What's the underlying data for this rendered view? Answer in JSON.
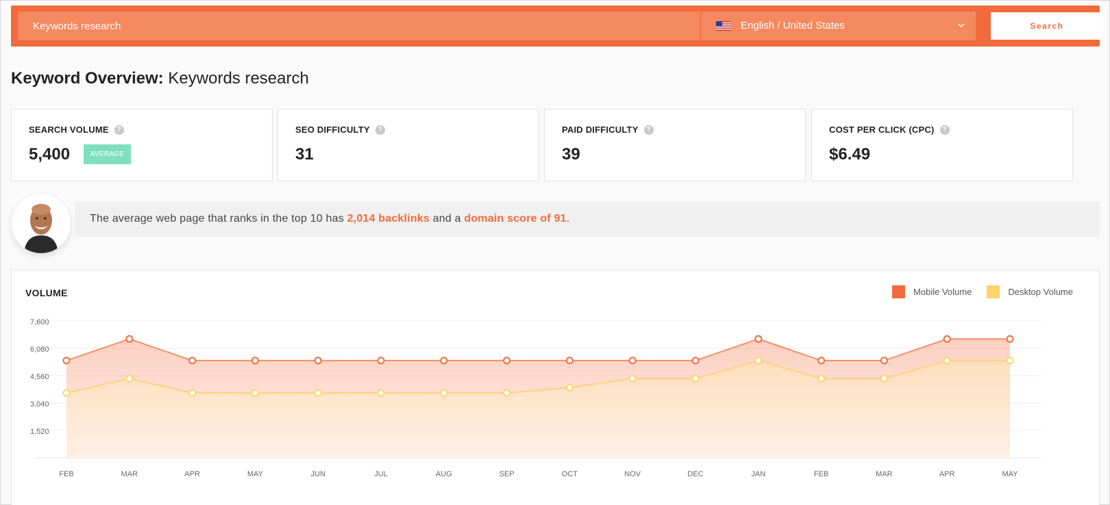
{
  "search": {
    "input_value": "Keywords research",
    "language_label": "English / United States",
    "button_label": "Search"
  },
  "page_title": {
    "prefix": "Keyword Overview:",
    "keyword": "Keywords research"
  },
  "metrics": [
    {
      "label": "SEARCH VOLUME",
      "value": "5,400",
      "badge": "AVERAGE"
    },
    {
      "label": "SEO DIFFICULTY",
      "value": "31"
    },
    {
      "label": "PAID DIFFICULTY",
      "value": "39"
    },
    {
      "label": "COST PER CLICK (CPC)",
      "value": "$6.49"
    }
  ],
  "help_glyph": "?",
  "insight": {
    "text_before": "The average web page that ranks in the top 10 has ",
    "backlinks": "2,014 backlinks",
    "text_middle": " and a ",
    "domain_score": "domain score of 91",
    "text_after": "."
  },
  "colors": {
    "brand": "#f36a3c",
    "mobile": "#f36a3c",
    "desktop": "#ffd36b",
    "badge": "#7fe0c0"
  },
  "chart_data": {
    "type": "area",
    "title": "VOLUME",
    "categories": [
      "FEB",
      "MAR",
      "APR",
      "MAY",
      "JUN",
      "JUL",
      "AUG",
      "SEP",
      "OCT",
      "NOV",
      "DEC",
      "JAN",
      "FEB",
      "MAR",
      "APR",
      "MAY"
    ],
    "y_ticks": [
      "7,600",
      "6,080",
      "4,560",
      "3,040",
      "1,520"
    ],
    "ylim": [
      0,
      7600
    ],
    "grid": true,
    "legend_position": "top-right",
    "series": [
      {
        "name": "Mobile Volume",
        "color": "#f36a3c",
        "values": [
          5400,
          6600,
          5400,
          5400,
          5400,
          5400,
          5400,
          5400,
          5400,
          5400,
          5400,
          6600,
          5400,
          5400,
          6600,
          6600
        ]
      },
      {
        "name": "Desktop Volume",
        "color": "#ffd36b",
        "values": [
          3600,
          4400,
          3600,
          3600,
          3600,
          3600,
          3600,
          3600,
          3900,
          4400,
          4400,
          5400,
          4400,
          4400,
          5400,
          5400
        ]
      }
    ]
  }
}
